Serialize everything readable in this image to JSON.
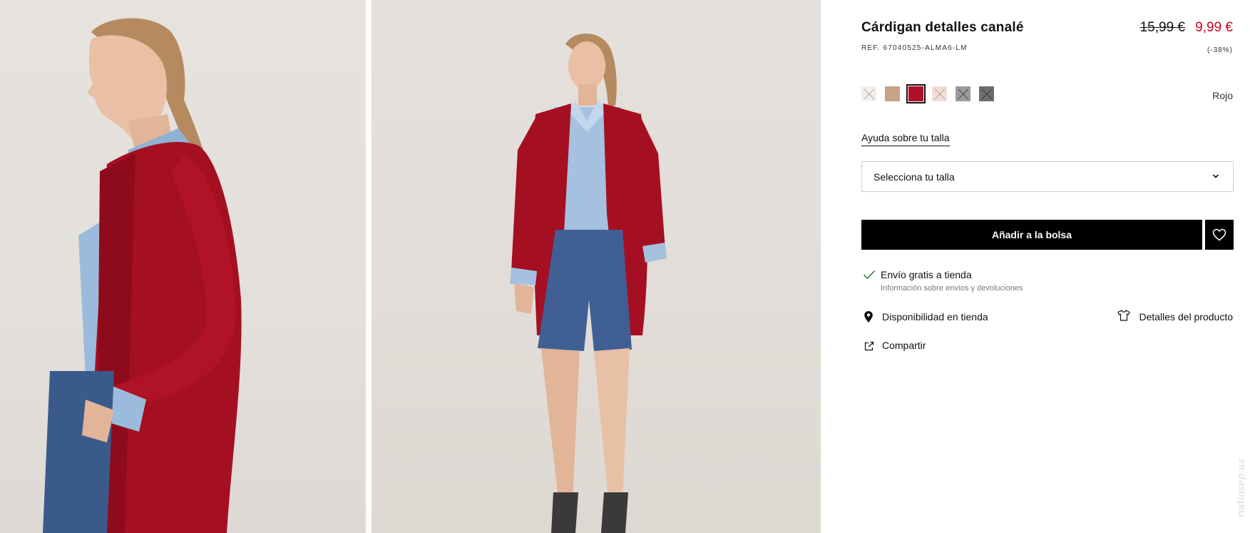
{
  "product": {
    "title": "Cárdigan detalles canalé",
    "ref": "REF. 67040525-ALMA6-LM",
    "price_old": "15,99 €",
    "price_new": "9,99 €",
    "discount": "(-38%)"
  },
  "colors": {
    "selected_name": "Rojo",
    "swatches": [
      {
        "color": "#f2efec",
        "crossed": true,
        "selected": false
      },
      {
        "color": "#c7a38a",
        "crossed": false,
        "selected": false
      },
      {
        "color": "#b0102a",
        "crossed": false,
        "selected": true
      },
      {
        "color": "#f3dcd7",
        "crossed": true,
        "selected": false
      },
      {
        "color": "#9b9b9b",
        "crossed": true,
        "selected": false
      },
      {
        "color": "#6e6e6e",
        "crossed": true,
        "selected": false
      }
    ]
  },
  "size": {
    "help_label": "Ayuda sobre tu talla",
    "select_placeholder": "Selecciona tu talla"
  },
  "actions": {
    "add_to_bag": "Añadir a la bolsa"
  },
  "shipping": {
    "title": "Envío gratis a tienda",
    "info_link": "Información sobre envíos y devoluciones"
  },
  "links": {
    "availability": "Disponibilidad en tienda",
    "details": "Detalles del producto",
    "share": "Compartir"
  },
  "watermark": "radiosep.us",
  "theme": {
    "sale_red": "#d0021b",
    "button_black": "#000000",
    "check_green": "#2e7d32"
  }
}
